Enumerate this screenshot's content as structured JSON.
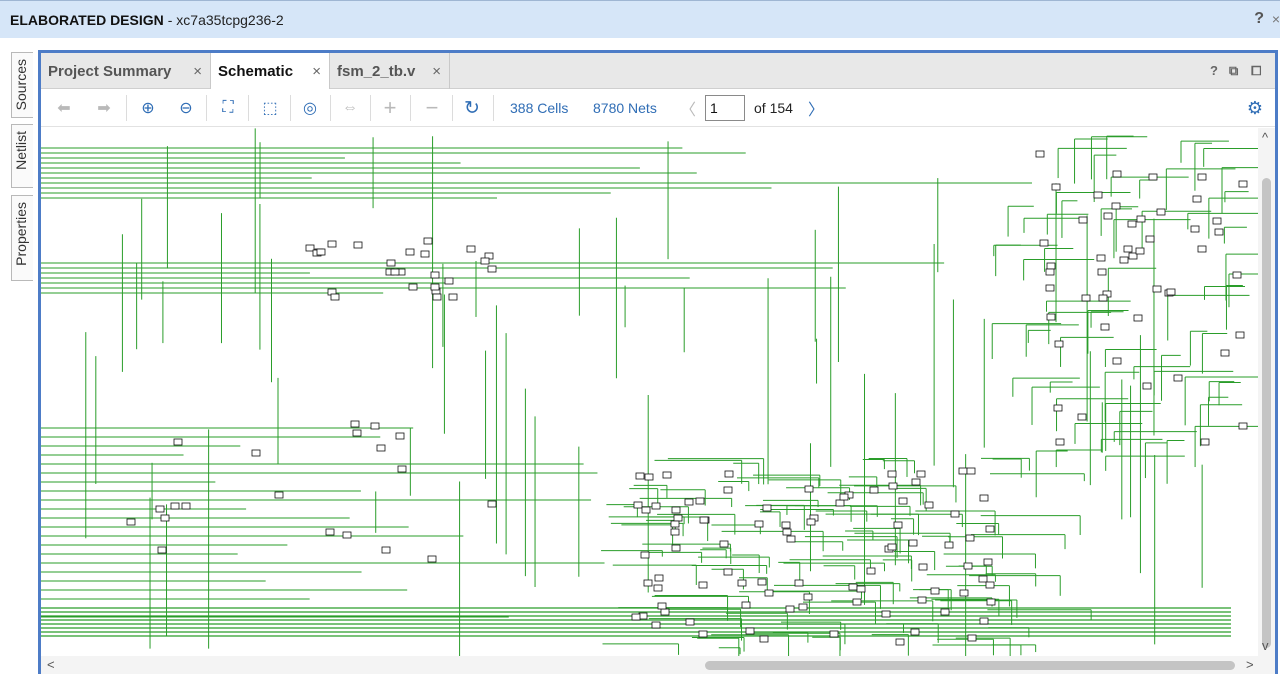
{
  "window": {
    "title_bold": "ELABORATED DESIGN",
    "title_rest": "- xc7a35tcpg236-2",
    "help": "?",
    "close": "×"
  },
  "side_tabs": [
    {
      "label": "Sources"
    },
    {
      "label": "Netlist"
    },
    {
      "label": "Properties"
    }
  ],
  "tabs": [
    {
      "label": "Project Summary",
      "close": "×"
    },
    {
      "label": "Schematic",
      "close": "×"
    },
    {
      "label": "fsm_2_tb.v",
      "close": "×"
    }
  ],
  "panel_icons": {
    "help": "?",
    "restore": "⧉",
    "maximize": "⧠"
  },
  "toolbar": {
    "back": "⬅",
    "forward": "➡",
    "zoom_in": "⊕",
    "zoom_out": "⊖",
    "fit": "⛶",
    "zoom_area": "⬚",
    "select": "◎",
    "regen": "⇔",
    "expand": "+",
    "collapse": "−",
    "refresh": "↻",
    "cells": "388 Cells",
    "nets": "8780 Nets",
    "prev": "〈",
    "page": "1",
    "of": "of 154",
    "next": "〉",
    "settings": "⚙"
  },
  "scroll": {
    "up": "^",
    "down": "v",
    "left": "<",
    "right": ">"
  },
  "colors": {
    "accent": "#4d7cc7",
    "wire": "#2a9d2a",
    "titlebar": "#d6e6f8",
    "link": "#2f6db5"
  }
}
